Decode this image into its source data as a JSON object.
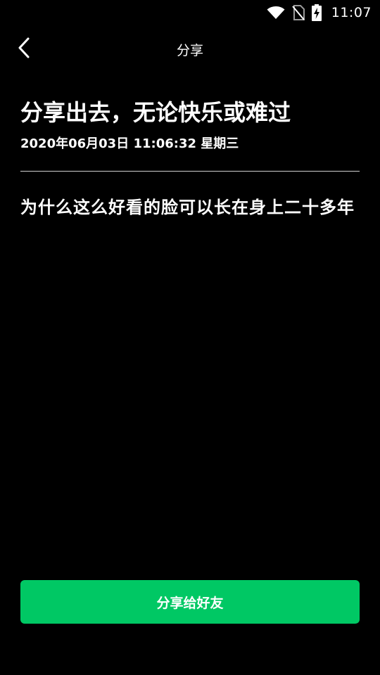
{
  "status_bar": {
    "time": "11:07",
    "icons": [
      "wifi-icon",
      "no-sim-icon",
      "battery-charging-icon"
    ]
  },
  "app_bar": {
    "title": "分享",
    "back_icon": "chevron-left-icon"
  },
  "content": {
    "headline": "分享出去，无论快乐或难过",
    "timestamp": "2020年06月03日 11:06:32 星期三",
    "body": "为什么这么好看的脸可以长在身上二十多年"
  },
  "actions": {
    "share_label": "分享给好友"
  },
  "colors": {
    "background": "#000000",
    "accent": "#00c864",
    "text": "#ffffff"
  }
}
